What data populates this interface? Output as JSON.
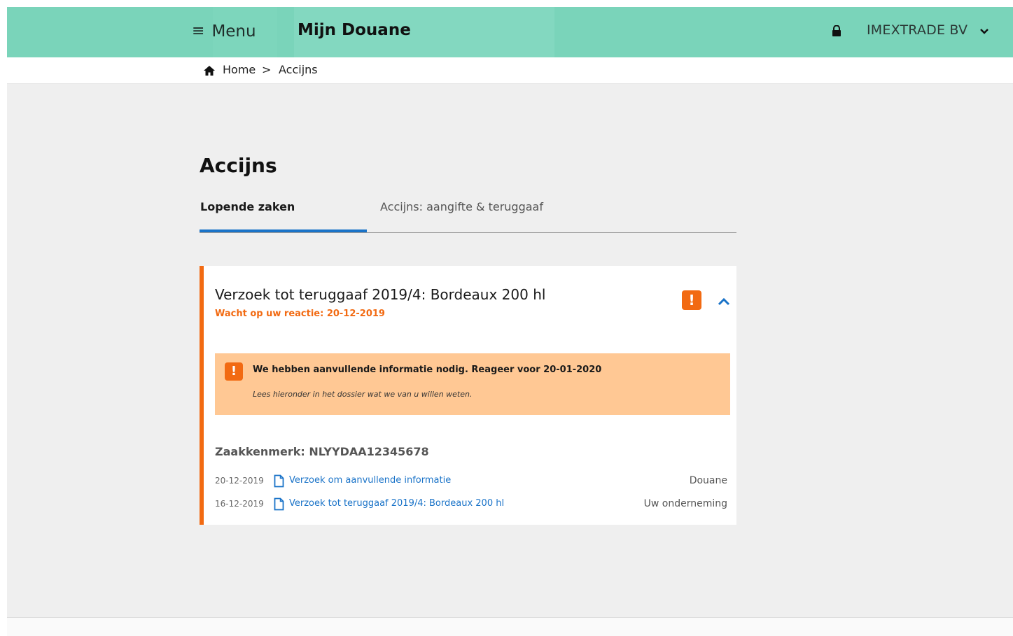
{
  "header": {
    "menu_label": "Menu",
    "app_title": "Mijn Douane",
    "company": "IMEXTRADE BV"
  },
  "breadcrumb": {
    "home": "Home",
    "separator": ">",
    "current": "Accijns"
  },
  "page": {
    "title": "Accijns",
    "tabs": [
      {
        "label": "Lopende zaken",
        "active": true
      },
      {
        "label": "Accijns: aangifte & teruggaaf",
        "active": false
      }
    ]
  },
  "case": {
    "title": "Verzoek tot teruggaaf 2019/4: Bordeaux 200 hl",
    "status": "Wacht op uw reactie: 20-12-2019",
    "notice": {
      "title": "We hebben aanvullende informatie nodig. Reageer voor 20-01-2020",
      "text": "Lees hieronder in het dossier wat we van u willen weten."
    },
    "reference": "Zaakkenmerk: NLYYDAA12345678",
    "documents": [
      {
        "date": "20-12-2019",
        "title": "Verzoek om aanvullende informatie",
        "party": "Douane"
      },
      {
        "date": "16-12-2019",
        "title": "Verzoek tot teruggaaf 2019/4: Bordeaux 200 hl",
        "party": "Uw onderneming"
      }
    ]
  },
  "colors": {
    "header_bg": "#7ad4ba",
    "accent_blue": "#1a73c8",
    "accent_orange": "#f26a12",
    "notice_bg": "#ffc894",
    "page_bg": "#efefef"
  },
  "icons": [
    "menu-icon",
    "lock-icon",
    "chevron-down-icon",
    "home-icon",
    "alert-icon",
    "chevron-up-icon",
    "document-icon"
  ]
}
